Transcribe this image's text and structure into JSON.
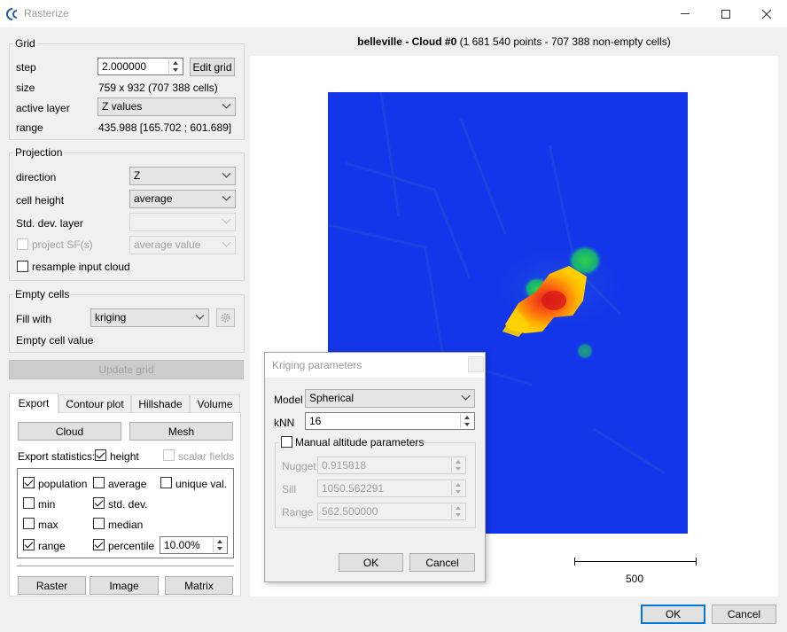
{
  "window": {
    "title": "Rasterize"
  },
  "grid": {
    "title": "Grid",
    "step_label": "step",
    "step_value": "2.000000",
    "edit_grid_label": "Edit grid",
    "size_label": "size",
    "size_value": "759 x 932 (707 388 cells)",
    "active_layer_label": "active layer",
    "active_layer_value": "Z values",
    "range_label": "range",
    "range_value": "435.988 [165.702 ; 601.689]"
  },
  "projection": {
    "title": "Projection",
    "direction_label": "direction",
    "direction_value": "Z",
    "cell_height_label": "cell height",
    "cell_height_value": "average",
    "std_dev_label": "Std. dev. layer",
    "std_dev_value": "",
    "project_sf_label": "project SF(s)",
    "project_sf_value": "average value",
    "resample_label": "resample input cloud"
  },
  "empty_cells": {
    "title": "Empty cells",
    "fill_with_label": "Fill with",
    "fill_with_value": "kriging",
    "empty_value_label": "Empty cell value"
  },
  "update_grid_label": "Update grid",
  "tabs": [
    "Export",
    "Contour plot",
    "Hillshade",
    "Volume"
  ],
  "export": {
    "cloud_label": "Cloud",
    "mesh_label": "Mesh",
    "stats_label": "Export statistics:",
    "height_label": "height",
    "scalar_fields_label": "scalar fields",
    "stats": {
      "population": "population",
      "average": "average",
      "unique": "unique val.",
      "min": "min",
      "std_dev": "std. dev.",
      "max": "max",
      "median": "median",
      "range": "range",
      "percentile": "percentile"
    },
    "percentile_value": "10.00%",
    "raster_label": "Raster",
    "image_label": "Image",
    "matrix_label": "Matrix"
  },
  "view": {
    "title_bold": "belleville - Cloud #0",
    "title_rest": " (1 681 540 points - 707 388 non-empty cells)",
    "scale_label": "500"
  },
  "kriging": {
    "title": "Kriging parameters",
    "model_label": "Model",
    "model_value": "Spherical",
    "knn_label": "kNN",
    "knn_value": "16",
    "manual_label": "Manual altitude parameters",
    "nugget_label": "Nugget",
    "nugget_value": "0.915818",
    "sill_label": "Sill",
    "sill_value": "1050.562291",
    "range_label": "Range",
    "range_value": "562.500000",
    "ok_label": "OK",
    "cancel_label": "Cancel"
  },
  "footer": {
    "ok_label": "OK",
    "cancel_label": "Cancel"
  }
}
